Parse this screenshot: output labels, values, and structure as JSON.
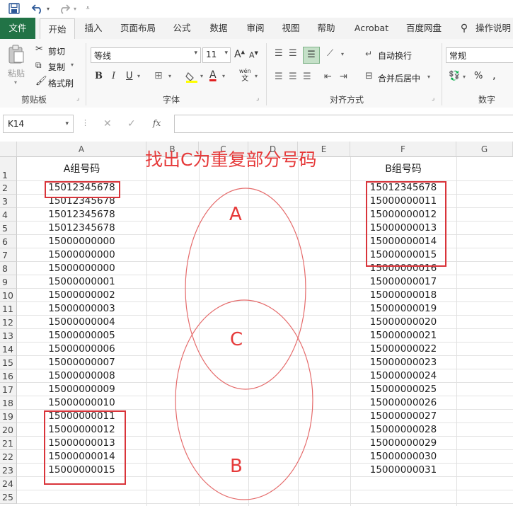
{
  "quick_access": {
    "icons": [
      "save-icon",
      "undo-icon",
      "redo-icon",
      "customize-icon"
    ]
  },
  "ribbon_tabs": [
    "文件",
    "开始",
    "插入",
    "页面布局",
    "公式",
    "数据",
    "审阅",
    "视图",
    "帮助",
    "Acrobat",
    "百度网盘",
    "操作说明"
  ],
  "active_tab": "开始",
  "clipboard": {
    "paste": "粘贴",
    "cut": "剪切",
    "copy": "复制",
    "format_painter": "格式刷",
    "label": "剪贴板"
  },
  "font": {
    "name": "等线",
    "size": "11",
    "grow": "A",
    "shrink": "A",
    "bold": "B",
    "italic": "I",
    "underline": "U",
    "font_color_letter": "A",
    "phonetic_top": "wén",
    "phonetic_bottom": "文",
    "label": "字体"
  },
  "alignment": {
    "wrap_text": "自动换行",
    "merge_center": "合并后居中",
    "label": "对齐方式"
  },
  "number": {
    "format": "常规",
    "percent": "%",
    "comma": ",",
    "label": "数字"
  },
  "formula_bar": {
    "name_box": "K14",
    "cancel": "✕",
    "enter": "✓",
    "fx": "fx",
    "value": ""
  },
  "columns": [
    "A",
    "B",
    "C",
    "D",
    "E",
    "F",
    "G"
  ],
  "rows": [
    "1",
    "2",
    "3",
    "4",
    "5",
    "6",
    "7",
    "8",
    "9",
    "10",
    "11",
    "12",
    "13",
    "14",
    "15",
    "16",
    "17",
    "18",
    "19",
    "20",
    "21",
    "22",
    "23",
    "24",
    "25"
  ],
  "col_a": {
    "header": "A组号码",
    "values": [
      "15012345678",
      "15012345678",
      "15012345678",
      "15012345678",
      "15000000000",
      "15000000000",
      "15000000000",
      "15000000001",
      "15000000002",
      "15000000003",
      "15000000004",
      "15000000005",
      "15000000006",
      "15000000007",
      "15000000008",
      "15000000009",
      "15000000010",
      "15000000011",
      "15000000012",
      "15000000013",
      "15000000014",
      "15000000015"
    ]
  },
  "col_f": {
    "header": "B组号码",
    "values": [
      "15012345678",
      "15000000011",
      "15000000012",
      "15000000013",
      "15000000014",
      "15000000015",
      "15000000016",
      "15000000017",
      "15000000018",
      "15000000019",
      "15000000020",
      "15000000021",
      "15000000022",
      "15000000023",
      "15000000024",
      "15000000025",
      "15000000026",
      "15000000027",
      "15000000028",
      "15000000029",
      "15000000030",
      "15000000031"
    ]
  },
  "annotation": {
    "title": "找出C为重复部分号码",
    "circle_a": "A",
    "circle_b": "B",
    "overlap_c": "C",
    "color": "#e63a3a"
  },
  "colors": {
    "file_tab": "#217346",
    "highlight_box": "#d9343a"
  }
}
